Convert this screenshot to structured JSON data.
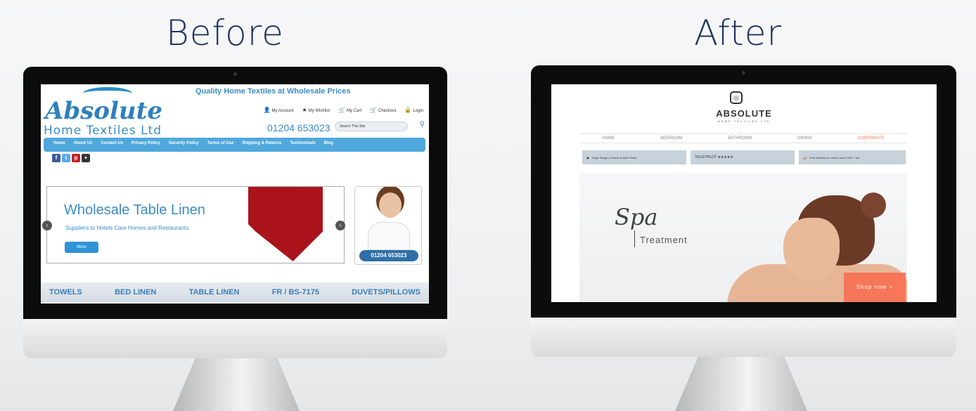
{
  "headings": {
    "before": "Before",
    "after": "After"
  },
  "before_site": {
    "logo": "Absolute",
    "logo_sub": "Home Textiles Ltd",
    "tagline": "Quality Home Textiles at Wholesale Prices",
    "account_links": [
      "My Account",
      "My Wishlist",
      "My Cart",
      "Checkout",
      "Login"
    ],
    "phone": "01204 653023",
    "search_placeholder": "Search This Site",
    "nav": [
      "Home",
      "About Us",
      "Contact Us",
      "Privacy Policy",
      "Security Policy",
      "Terms of Use",
      "Shipping & Returns",
      "Testimonials",
      "Blog"
    ],
    "hero": {
      "title": "Wholesale Table Linen",
      "subtitle": "Suppliers to Hotels Care Homes and Restaurants",
      "button": "More"
    },
    "support_phone": "01204 653023",
    "categories": [
      "TOWELS",
      "BED LINEN",
      "TABLE LINEN",
      "FR / BS-7175",
      "DUVETS/PILLOWS"
    ]
  },
  "after_site": {
    "logo": "ABSOLUTE",
    "logo_sub": "HOME TEXTILES LTD",
    "nav": [
      "HOME",
      "BEDROOM",
      "BATHROOM",
      "DINING",
      "CORPORATE"
    ],
    "usps": [
      "Huge Range of Stock at Bulk Prices",
      "TRUSTPILOT ★★★★★",
      "Free Delivery on orders over £150 + vat"
    ],
    "hero": {
      "script": "Spa",
      "text": "Treatment",
      "button": "Shop now >"
    }
  },
  "colors": {
    "heading": "#1f3560",
    "before_blue": "#3a8cc7",
    "after_accent": "#f6765a"
  }
}
